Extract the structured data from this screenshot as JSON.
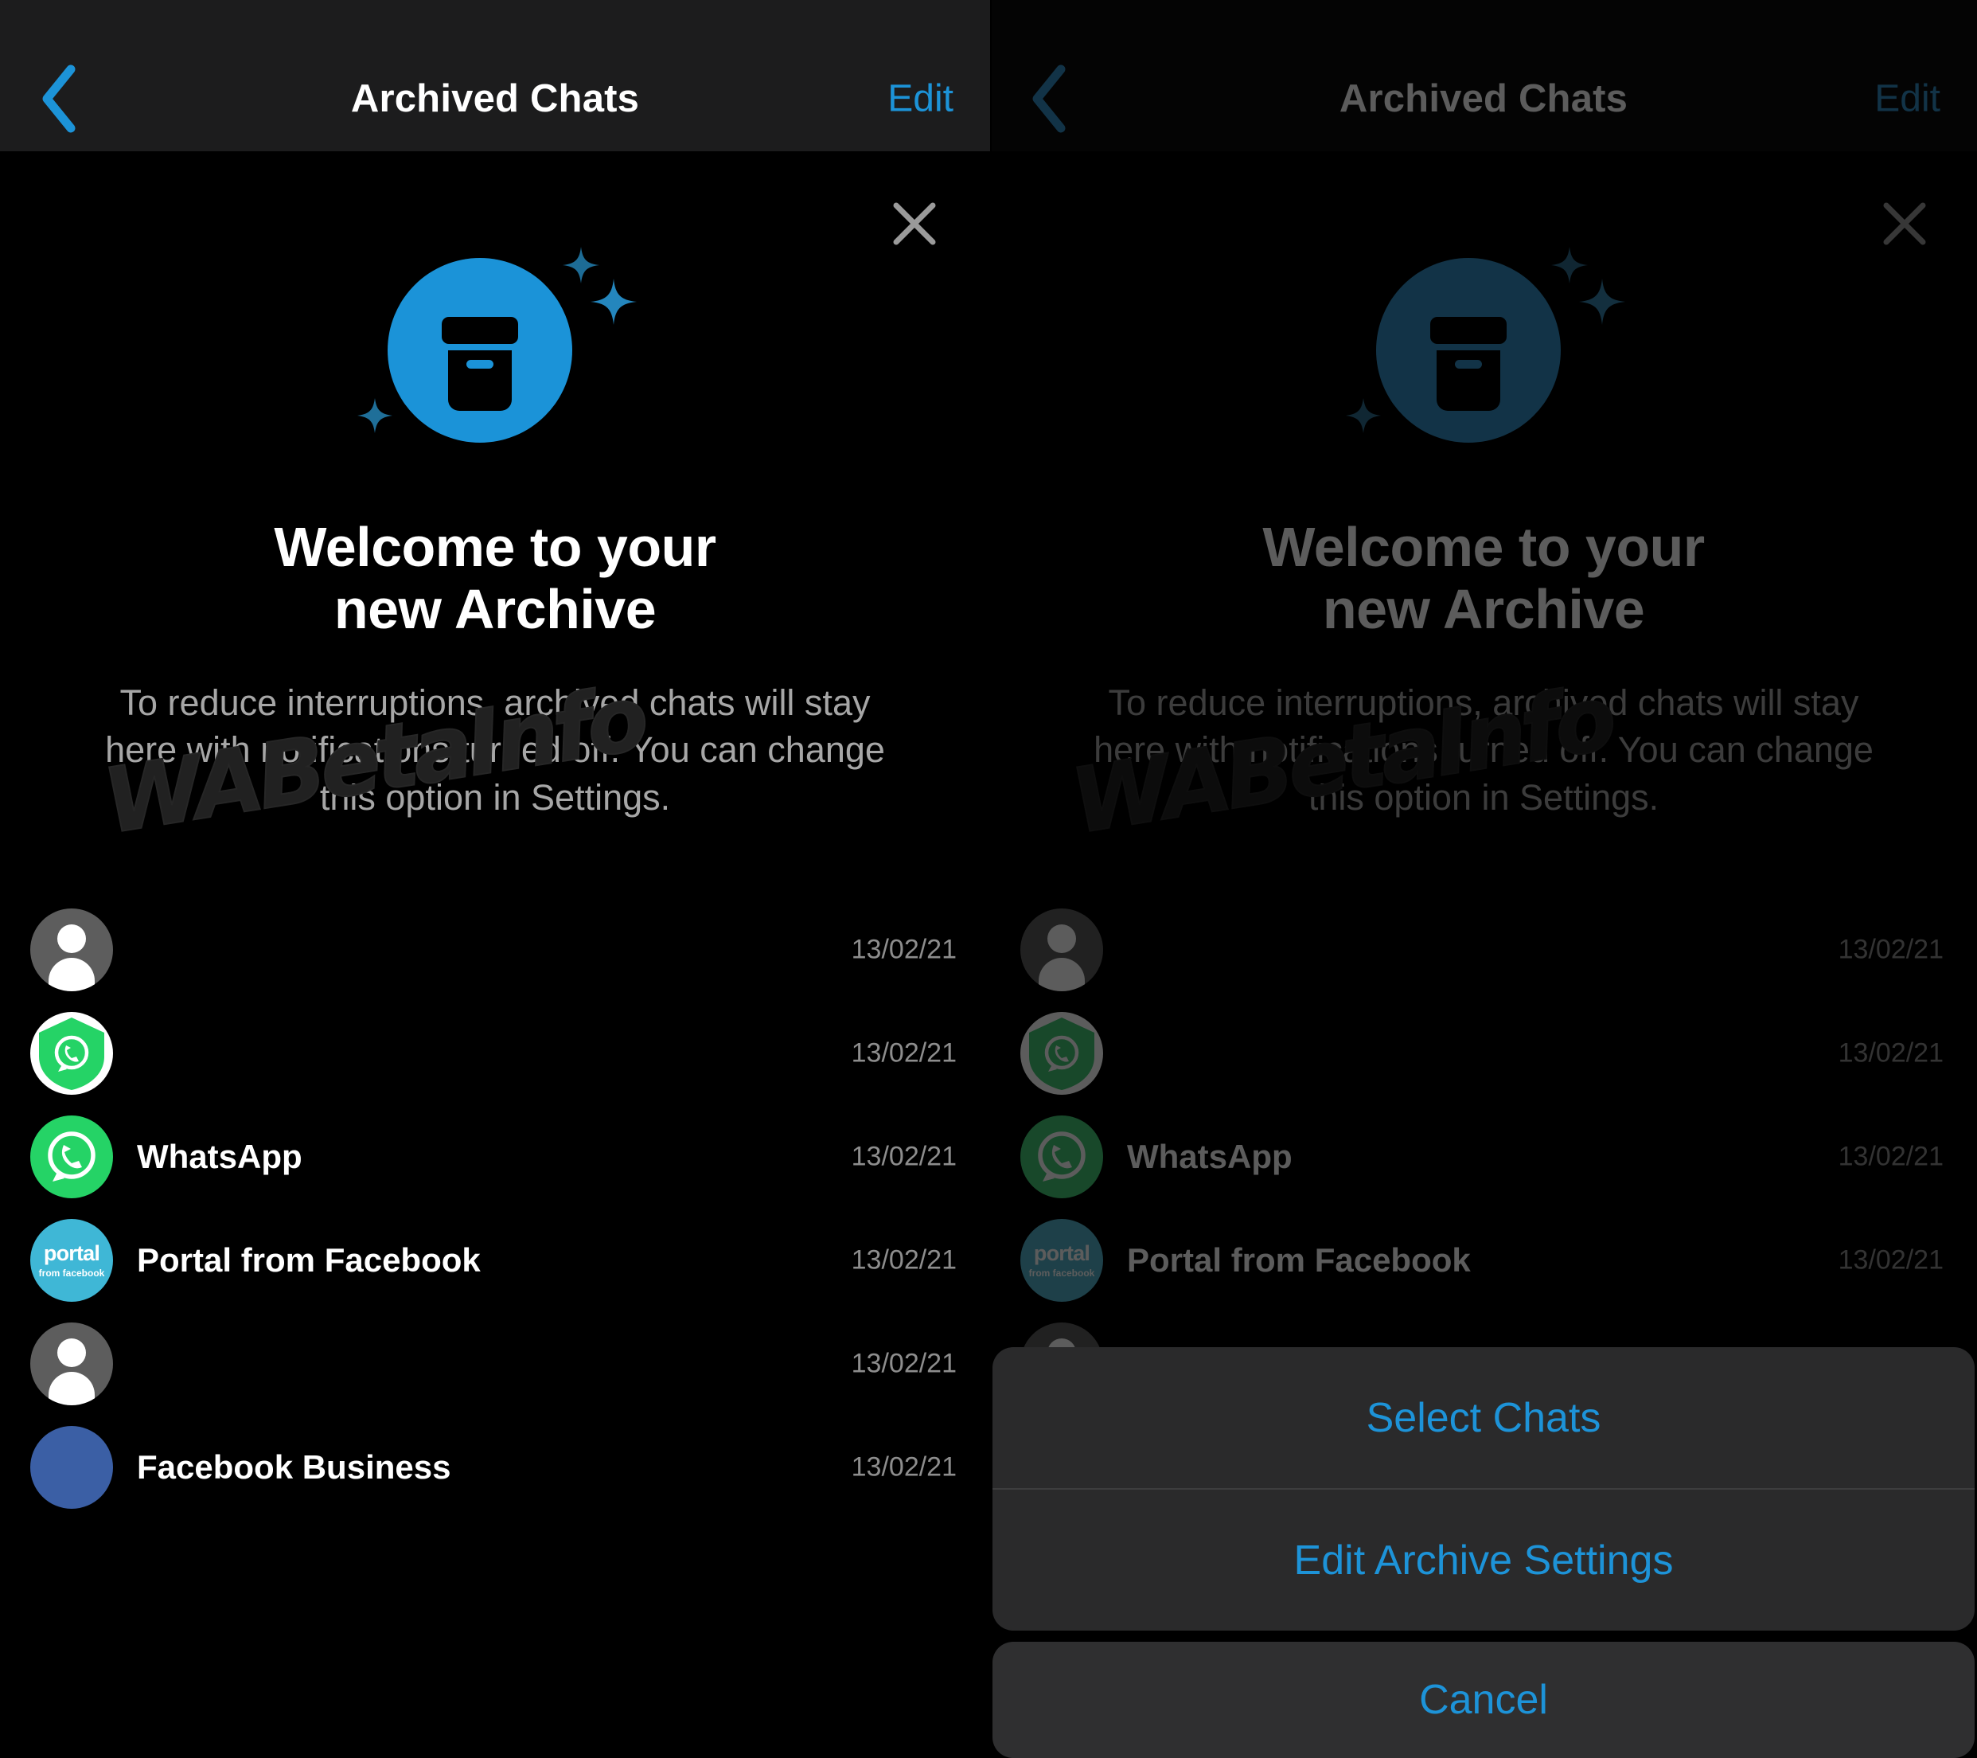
{
  "meta": {
    "watermark": "WABetaInfo",
    "accent_blue": "#1c93d8",
    "icon_blue": "#1b93d8",
    "whatsapp_green": "#25d366",
    "sheet_bg": "#2a2a2b",
    "navbar_bg": "#1c1c1d",
    "page_bg": "#000000",
    "secondary_text": "#a6a6a6",
    "date_text": "#8d8d8d"
  },
  "navbar": {
    "back_icon": "chevron-left-icon",
    "title": "Archived Chats",
    "edit_label": "Edit"
  },
  "hero": {
    "close_icon": "close-icon",
    "archive_icon": "archive-box-icon",
    "sparkle_icon": "sparkle-icon",
    "title_line1": "Welcome to your",
    "title_line2": "new Archive",
    "body": "To reduce interruptions, archived chats will stay here with notifications turned off. You can change this option in Settings."
  },
  "chats": [
    {
      "name": "",
      "date": "13/02/21",
      "avatar": "default-person-avatar"
    },
    {
      "name": "",
      "date": "13/02/21",
      "avatar": "whatsapp-verified-avatar"
    },
    {
      "name": "WhatsApp",
      "date": "13/02/21",
      "avatar": "whatsapp-avatar"
    },
    {
      "name": "Portal from Facebook",
      "date": "13/02/21",
      "avatar": "portal-avatar",
      "avatar_line1": "portal",
      "avatar_line2": "from facebook"
    },
    {
      "name": "",
      "date": "13/02/21",
      "avatar": "default-person-avatar"
    },
    {
      "name": "Facebook Business",
      "date": "13/02/21",
      "avatar": "facebook-business-avatar"
    }
  ],
  "action_sheet": {
    "select_chats_label": "Select Chats",
    "edit_archive_settings_label": "Edit Archive Settings",
    "cancel_label": "Cancel"
  }
}
